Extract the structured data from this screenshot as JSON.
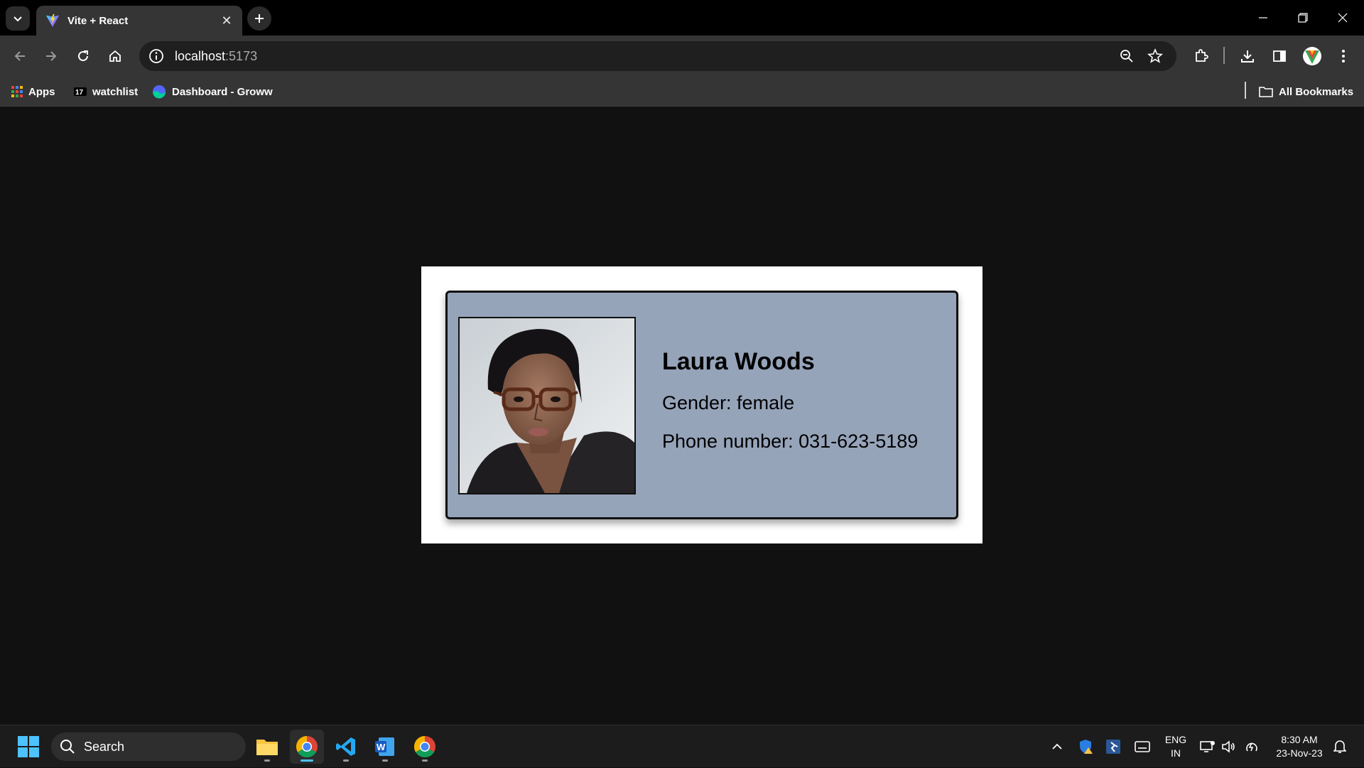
{
  "browser": {
    "tab": {
      "title": "Vite + React",
      "close_label": "✕"
    },
    "address": {
      "host": "localhost",
      "port": ":5173"
    },
    "bookmarks": [
      {
        "label": "Apps"
      },
      {
        "label": "watchlist"
      },
      {
        "label": "Dashboard - Groww"
      }
    ],
    "all_bookmarks_label": "All Bookmarks",
    "profile_initial": "V"
  },
  "profile": {
    "name": "Laura Woods",
    "gender_text": "Gender: female",
    "phone_text": "Phone number: 031-623-5189"
  },
  "taskbar": {
    "search_placeholder": "Search",
    "language_line1": "ENG",
    "language_line2": "IN",
    "time": "8:30 AM",
    "date": "23-Nov-23"
  },
  "colors": {
    "page_background": "#111111",
    "card_background": "#96a4ba",
    "outer_card": "#ffffff",
    "browser_chrome": "#353535",
    "active_indicator": "#4cc2ff"
  }
}
